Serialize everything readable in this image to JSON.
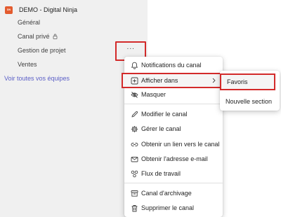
{
  "team": {
    "avatar_text": "DN",
    "avatar_color": "#e35b2e",
    "name": "DEMO - Digital Ninja"
  },
  "channels": [
    {
      "label": "Général"
    },
    {
      "label": "Canal privé",
      "icon": "lock-icon"
    },
    {
      "label": "Gestion de projet"
    },
    {
      "label": "Ventes"
    }
  ],
  "see_all_label": "Voir toutes vos équipes",
  "more_button_label": "···",
  "context_menu": {
    "items": [
      {
        "label": "Notifications du canal",
        "icon": "bell-icon"
      },
      {
        "label": "Afficher dans",
        "icon": "add-square-icon",
        "has_submenu": true
      },
      {
        "label": "Masquer",
        "icon": "eye-off-icon"
      },
      {
        "label": "Modifier le canal",
        "icon": "pencil-icon"
      },
      {
        "label": "Gérer le canal",
        "icon": "gear-icon"
      },
      {
        "label": "Obtenir un lien vers le canal",
        "icon": "link-icon"
      },
      {
        "label": "Obtenir l'adresse e-mail",
        "icon": "mail-icon"
      },
      {
        "label": "Flux de travail",
        "icon": "workflow-icon"
      },
      {
        "label": "Canal d'archivage",
        "icon": "archive-icon"
      },
      {
        "label": "Supprimer le canal",
        "icon": "trash-icon"
      }
    ]
  },
  "submenu": {
    "items": [
      {
        "label": "Favoris"
      },
      {
        "label": "Nouvelle section"
      }
    ]
  },
  "colors": {
    "highlight_border": "#d32a2a",
    "link": "#5b5fc7",
    "sidebar_bg": "#f0f0f0"
  }
}
